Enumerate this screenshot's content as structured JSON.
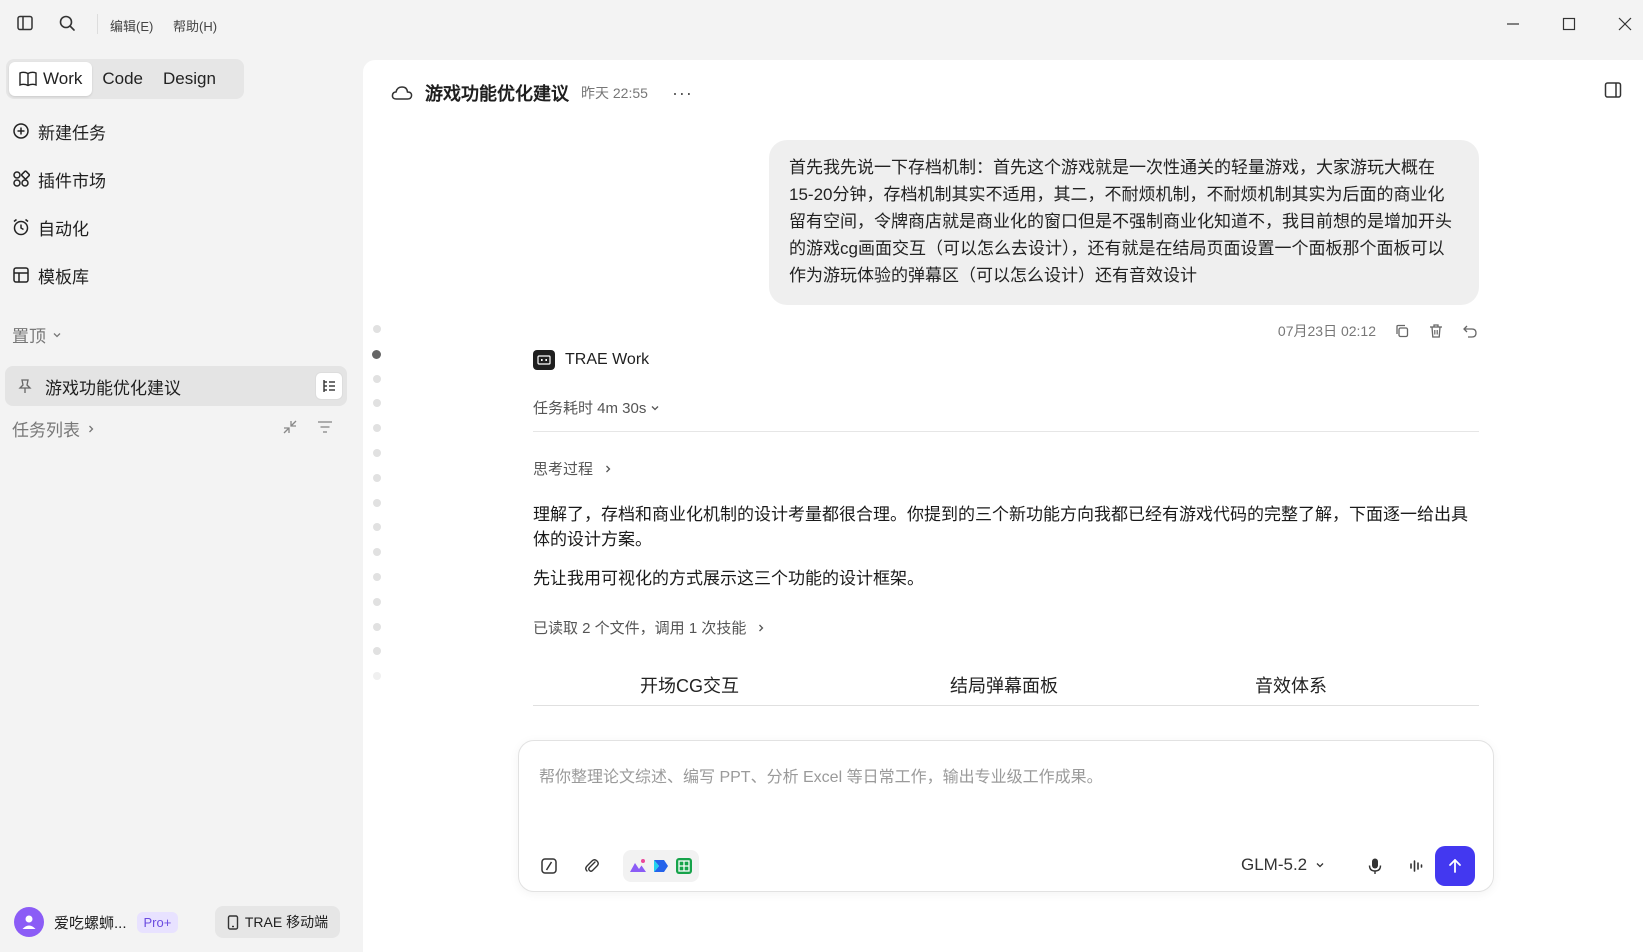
{
  "titlebar": {
    "menu_edit": "编辑(E)",
    "menu_help": "帮助(H)"
  },
  "sidebar": {
    "modes": [
      "Work",
      "Code",
      "Design"
    ],
    "active_mode": "Work",
    "nav": [
      {
        "label": "新建任务",
        "icon": "plus-circle-icon"
      },
      {
        "label": "插件市场",
        "icon": "apps-icon"
      },
      {
        "label": "自动化",
        "icon": "clock-icon"
      },
      {
        "label": "模板库",
        "icon": "template-icon"
      }
    ],
    "pinned_label": "置顶",
    "pinned_item": "游戏功能优化建议",
    "task_list_label": "任务列表",
    "user_name": "爱吃螺蛳...",
    "plan_badge": "Pro+",
    "mobile_label": "TRAE 移动端"
  },
  "chat": {
    "title": "游戏功能优化建议",
    "time": "昨天 22:55",
    "more": "···",
    "user_message": "首先我先说一下存档机制：首先这个游戏就是一次性通关的轻量游戏，大家游玩大概在15-20分钟，存档机制其实不适用，其二，不耐烦机制，不耐烦机制其实为后面的商业化留有空间，令牌商店就是商业化的窗口但是不强制商业化知道不，我目前想的是增加开头的游戏cg画面交互（可以怎么去设计），还有就是在结局页面设置一个面板那个面板可以作为游玩体验的弹幕区（可以怎么设计）还有音效设计",
    "user_message_time": "07月23日 02:12",
    "agent_name": "TRAE Work",
    "duration": "任务耗时 4m 30s",
    "thinking_label": "思考过程",
    "answer_p1": "理解了，存档和商业化机制的设计考量都很合理。你提到的三个新功能方向我都已经有游戏代码的完整了解，下面逐一给出具体的设计方案。",
    "answer_p2": "先让我用可视化的方式展示这三个功能的设计框架。",
    "read_files": "已读取 2 个文件，调用 1 次技能",
    "feature_tabs": [
      "开场CG交互",
      "结局弹幕面板",
      "音效体系"
    ]
  },
  "composer": {
    "placeholder": "帮你整理论文综述、编写 PPT、分析 Excel 等日常工作，输出专业级工作成果。",
    "model": "GLM-5.2"
  },
  "colors": {
    "accent": "#4338f0",
    "sidebar_bg": "#f3f3f3",
    "bubble_bg": "#efefef"
  }
}
